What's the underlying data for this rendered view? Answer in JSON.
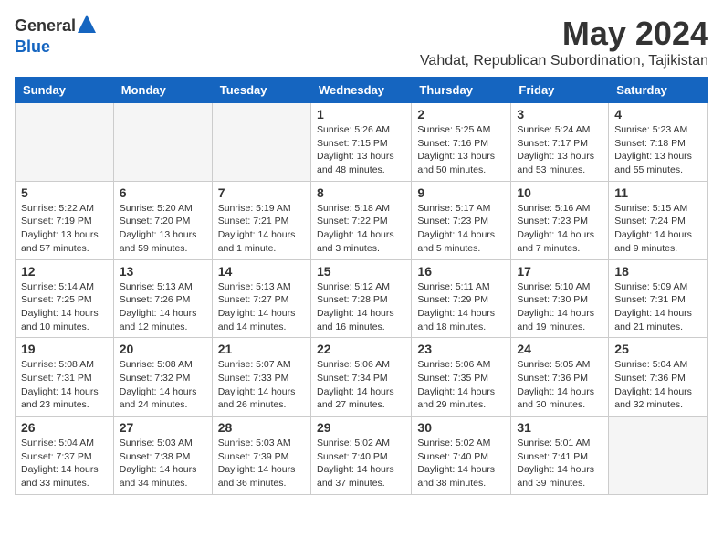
{
  "logo": {
    "general": "General",
    "blue": "Blue"
  },
  "title": "May 2024",
  "location": "Vahdat, Republican Subordination, Tajikistan",
  "days_of_week": [
    "Sunday",
    "Monday",
    "Tuesday",
    "Wednesday",
    "Thursday",
    "Friday",
    "Saturday"
  ],
  "weeks": [
    [
      {
        "day": "",
        "sunrise": "",
        "sunset": "",
        "daylight": "",
        "empty": true
      },
      {
        "day": "",
        "sunrise": "",
        "sunset": "",
        "daylight": "",
        "empty": true
      },
      {
        "day": "",
        "sunrise": "",
        "sunset": "",
        "daylight": "",
        "empty": true
      },
      {
        "day": "1",
        "sunrise": "Sunrise: 5:26 AM",
        "sunset": "Sunset: 7:15 PM",
        "daylight": "Daylight: 13 hours and 48 minutes."
      },
      {
        "day": "2",
        "sunrise": "Sunrise: 5:25 AM",
        "sunset": "Sunset: 7:16 PM",
        "daylight": "Daylight: 13 hours and 50 minutes."
      },
      {
        "day": "3",
        "sunrise": "Sunrise: 5:24 AM",
        "sunset": "Sunset: 7:17 PM",
        "daylight": "Daylight: 13 hours and 53 minutes."
      },
      {
        "day": "4",
        "sunrise": "Sunrise: 5:23 AM",
        "sunset": "Sunset: 7:18 PM",
        "daylight": "Daylight: 13 hours and 55 minutes."
      }
    ],
    [
      {
        "day": "5",
        "sunrise": "Sunrise: 5:22 AM",
        "sunset": "Sunset: 7:19 PM",
        "daylight": "Daylight: 13 hours and 57 minutes."
      },
      {
        "day": "6",
        "sunrise": "Sunrise: 5:20 AM",
        "sunset": "Sunset: 7:20 PM",
        "daylight": "Daylight: 13 hours and 59 minutes."
      },
      {
        "day": "7",
        "sunrise": "Sunrise: 5:19 AM",
        "sunset": "Sunset: 7:21 PM",
        "daylight": "Daylight: 14 hours and 1 minute."
      },
      {
        "day": "8",
        "sunrise": "Sunrise: 5:18 AM",
        "sunset": "Sunset: 7:22 PM",
        "daylight": "Daylight: 14 hours and 3 minutes."
      },
      {
        "day": "9",
        "sunrise": "Sunrise: 5:17 AM",
        "sunset": "Sunset: 7:23 PM",
        "daylight": "Daylight: 14 hours and 5 minutes."
      },
      {
        "day": "10",
        "sunrise": "Sunrise: 5:16 AM",
        "sunset": "Sunset: 7:23 PM",
        "daylight": "Daylight: 14 hours and 7 minutes."
      },
      {
        "day": "11",
        "sunrise": "Sunrise: 5:15 AM",
        "sunset": "Sunset: 7:24 PM",
        "daylight": "Daylight: 14 hours and 9 minutes."
      }
    ],
    [
      {
        "day": "12",
        "sunrise": "Sunrise: 5:14 AM",
        "sunset": "Sunset: 7:25 PM",
        "daylight": "Daylight: 14 hours and 10 minutes."
      },
      {
        "day": "13",
        "sunrise": "Sunrise: 5:13 AM",
        "sunset": "Sunset: 7:26 PM",
        "daylight": "Daylight: 14 hours and 12 minutes."
      },
      {
        "day": "14",
        "sunrise": "Sunrise: 5:13 AM",
        "sunset": "Sunset: 7:27 PM",
        "daylight": "Daylight: 14 hours and 14 minutes."
      },
      {
        "day": "15",
        "sunrise": "Sunrise: 5:12 AM",
        "sunset": "Sunset: 7:28 PM",
        "daylight": "Daylight: 14 hours and 16 minutes."
      },
      {
        "day": "16",
        "sunrise": "Sunrise: 5:11 AM",
        "sunset": "Sunset: 7:29 PM",
        "daylight": "Daylight: 14 hours and 18 minutes."
      },
      {
        "day": "17",
        "sunrise": "Sunrise: 5:10 AM",
        "sunset": "Sunset: 7:30 PM",
        "daylight": "Daylight: 14 hours and 19 minutes."
      },
      {
        "day": "18",
        "sunrise": "Sunrise: 5:09 AM",
        "sunset": "Sunset: 7:31 PM",
        "daylight": "Daylight: 14 hours and 21 minutes."
      }
    ],
    [
      {
        "day": "19",
        "sunrise": "Sunrise: 5:08 AM",
        "sunset": "Sunset: 7:31 PM",
        "daylight": "Daylight: 14 hours and 23 minutes."
      },
      {
        "day": "20",
        "sunrise": "Sunrise: 5:08 AM",
        "sunset": "Sunset: 7:32 PM",
        "daylight": "Daylight: 14 hours and 24 minutes."
      },
      {
        "day": "21",
        "sunrise": "Sunrise: 5:07 AM",
        "sunset": "Sunset: 7:33 PM",
        "daylight": "Daylight: 14 hours and 26 minutes."
      },
      {
        "day": "22",
        "sunrise": "Sunrise: 5:06 AM",
        "sunset": "Sunset: 7:34 PM",
        "daylight": "Daylight: 14 hours and 27 minutes."
      },
      {
        "day": "23",
        "sunrise": "Sunrise: 5:06 AM",
        "sunset": "Sunset: 7:35 PM",
        "daylight": "Daylight: 14 hours and 29 minutes."
      },
      {
        "day": "24",
        "sunrise": "Sunrise: 5:05 AM",
        "sunset": "Sunset: 7:36 PM",
        "daylight": "Daylight: 14 hours and 30 minutes."
      },
      {
        "day": "25",
        "sunrise": "Sunrise: 5:04 AM",
        "sunset": "Sunset: 7:36 PM",
        "daylight": "Daylight: 14 hours and 32 minutes."
      }
    ],
    [
      {
        "day": "26",
        "sunrise": "Sunrise: 5:04 AM",
        "sunset": "Sunset: 7:37 PM",
        "daylight": "Daylight: 14 hours and 33 minutes."
      },
      {
        "day": "27",
        "sunrise": "Sunrise: 5:03 AM",
        "sunset": "Sunset: 7:38 PM",
        "daylight": "Daylight: 14 hours and 34 minutes."
      },
      {
        "day": "28",
        "sunrise": "Sunrise: 5:03 AM",
        "sunset": "Sunset: 7:39 PM",
        "daylight": "Daylight: 14 hours and 36 minutes."
      },
      {
        "day": "29",
        "sunrise": "Sunrise: 5:02 AM",
        "sunset": "Sunset: 7:40 PM",
        "daylight": "Daylight: 14 hours and 37 minutes."
      },
      {
        "day": "30",
        "sunrise": "Sunrise: 5:02 AM",
        "sunset": "Sunset: 7:40 PM",
        "daylight": "Daylight: 14 hours and 38 minutes."
      },
      {
        "day": "31",
        "sunrise": "Sunrise: 5:01 AM",
        "sunset": "Sunset: 7:41 PM",
        "daylight": "Daylight: 14 hours and 39 minutes."
      },
      {
        "day": "",
        "sunrise": "",
        "sunset": "",
        "daylight": "",
        "empty": true
      }
    ]
  ]
}
